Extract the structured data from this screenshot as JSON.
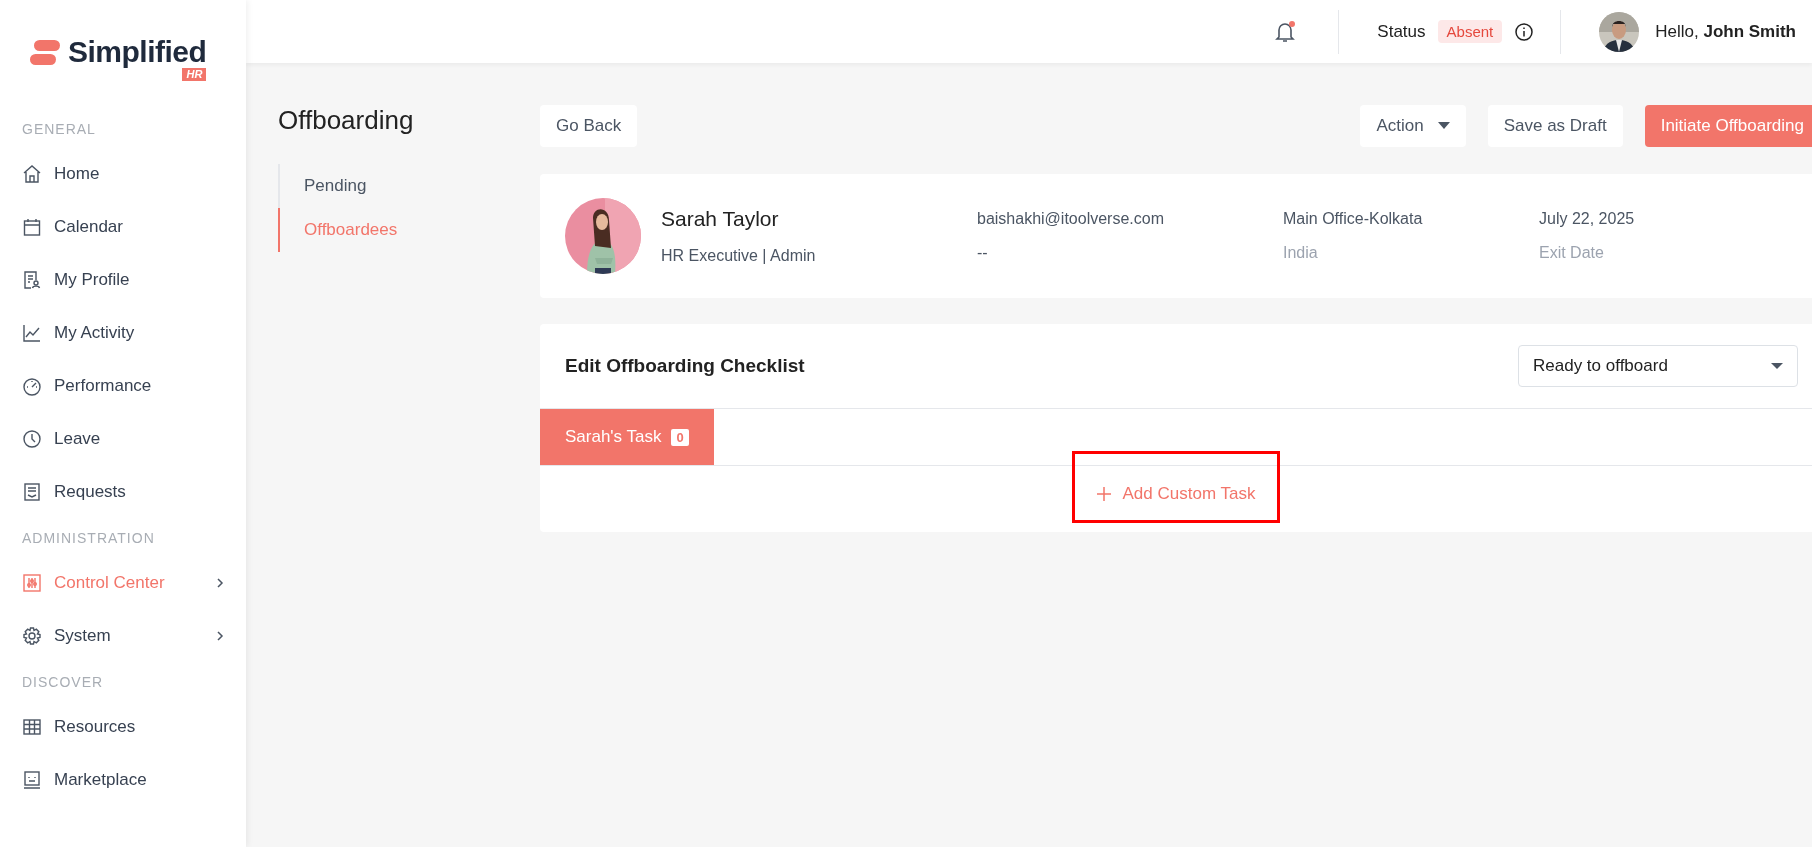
{
  "brand": {
    "name": "Simplified",
    "tag": "HR"
  },
  "sidebar": {
    "sections": [
      {
        "label": "GENERAL",
        "items": [
          {
            "label": "Home",
            "selected": false,
            "expandable": false
          },
          {
            "label": "Calendar",
            "selected": false,
            "expandable": false
          },
          {
            "label": "My Profile",
            "selected": false,
            "expandable": false
          },
          {
            "label": "My Activity",
            "selected": false,
            "expandable": false
          },
          {
            "label": "Performance",
            "selected": false,
            "expandable": false
          },
          {
            "label": "Leave",
            "selected": false,
            "expandable": false
          },
          {
            "label": "Requests",
            "selected": false,
            "expandable": false
          }
        ]
      },
      {
        "label": "ADMINISTRATION",
        "items": [
          {
            "label": "Control Center",
            "selected": true,
            "expandable": true
          },
          {
            "label": "System",
            "selected": false,
            "expandable": true
          }
        ]
      },
      {
        "label": "DISCOVER",
        "items": [
          {
            "label": "Resources",
            "selected": false,
            "expandable": false
          },
          {
            "label": "Marketplace",
            "selected": false,
            "expandable": false
          }
        ]
      }
    ]
  },
  "header": {
    "notification": true,
    "status_label": "Status",
    "status": "Absent",
    "greeting": "Hello,",
    "user": "John Smith"
  },
  "page": {
    "title": "Offboarding",
    "subnav": [
      {
        "label": "Pending",
        "selected": false
      },
      {
        "label": "Offboardees",
        "selected": true
      }
    ]
  },
  "toolbar": {
    "back": "Go Back",
    "action": "Action",
    "draft": "Save as Draft",
    "primary": "Initiate Offboarding"
  },
  "employee": {
    "name": "Sarah Taylor",
    "role": "HR Executive | Admin",
    "email": "baishakhi@itoolverse.com",
    "phone": "--",
    "office": "Main Office-Kolkata",
    "country": "India",
    "date": "July 22, 2025",
    "date_label": "Exit Date"
  },
  "checklist": {
    "title": "Edit Offboarding Checklist",
    "status": "Ready to offboard",
    "tabs": [
      {
        "label": "Sarah's Task",
        "count": "0",
        "selected": true
      }
    ],
    "add_task": {
      "label": "Add Custom Task",
      "highlighted": true
    }
  }
}
